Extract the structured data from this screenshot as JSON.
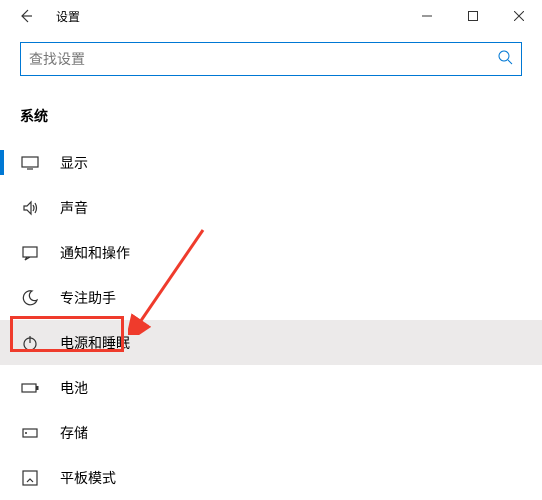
{
  "titlebar": {
    "back_label": "返回",
    "title": "设置",
    "minimize": "最小化",
    "maximize": "最大化",
    "close": "关闭"
  },
  "search": {
    "placeholder": "查找设置"
  },
  "section": {
    "header": "系统"
  },
  "nav": {
    "items": [
      {
        "label": "显示",
        "icon": "display-icon"
      },
      {
        "label": "声音",
        "icon": "sound-icon"
      },
      {
        "label": "通知和操作",
        "icon": "notification-icon"
      },
      {
        "label": "专注助手",
        "icon": "focus-icon"
      },
      {
        "label": "电源和睡眠",
        "icon": "power-icon"
      },
      {
        "label": "电池",
        "icon": "battery-icon"
      },
      {
        "label": "存储",
        "icon": "storage-icon"
      },
      {
        "label": "平板模式",
        "icon": "tablet-icon"
      }
    ]
  },
  "annotation": {
    "highlight_target": "电源和睡眠"
  }
}
